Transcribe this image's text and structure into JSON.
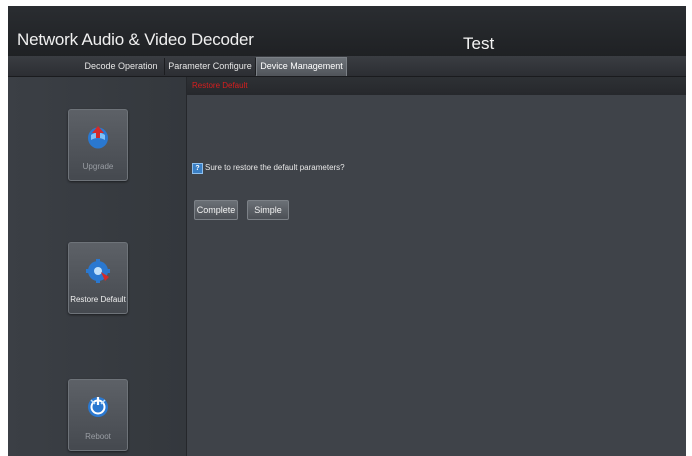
{
  "app": {
    "title": "Network Audio & Video Decoder",
    "device_name": "Test"
  },
  "tabs": [
    {
      "label": "Decode Operation",
      "active": false
    },
    {
      "label": "Parameter Configure",
      "active": false
    },
    {
      "label": "Device Management",
      "active": true
    }
  ],
  "sidebar": {
    "items": [
      {
        "label": "Upgrade",
        "icon": "upgrade-icon",
        "active": false
      },
      {
        "label": "Restore Default",
        "icon": "restore-default-icon",
        "active": true
      },
      {
        "label": "Reboot",
        "icon": "reboot-icon",
        "active": false
      }
    ]
  },
  "main": {
    "section_title": "Restore Default",
    "prompt": "Sure to restore the default parameters?",
    "buttons": {
      "complete": "Complete",
      "simple": "Simple"
    }
  },
  "colors": {
    "background": "#2f3237",
    "section_title": "#d81e1e",
    "accent_blue": "#2a78d0"
  }
}
